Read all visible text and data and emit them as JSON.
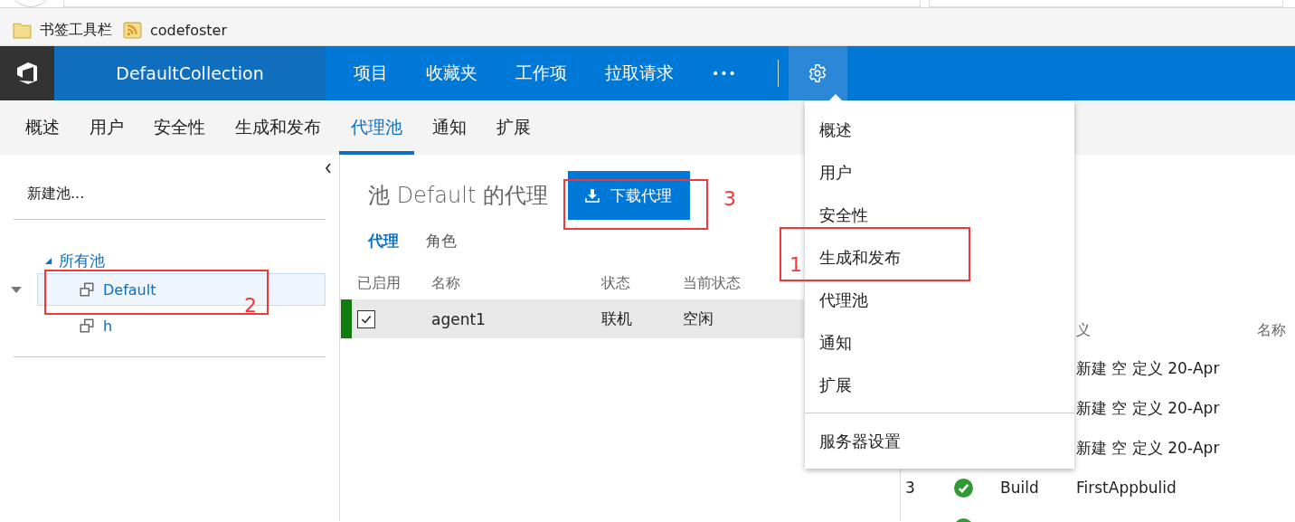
{
  "browser": {
    "bookmarks": [
      {
        "kind": "folder",
        "label": "书签工具栏"
      },
      {
        "kind": "feed",
        "label": "codefoster"
      }
    ]
  },
  "header": {
    "collection": "DefaultCollection",
    "nav": [
      {
        "label": "项目"
      },
      {
        "label": "收藏夹"
      },
      {
        "label": "工作项"
      },
      {
        "label": "拉取请求"
      }
    ],
    "more": "•••",
    "settings_open": true
  },
  "subnav": [
    {
      "label": "概述",
      "selected": false
    },
    {
      "label": "用户",
      "selected": false
    },
    {
      "label": "安全性",
      "selected": false
    },
    {
      "label": "生成和发布",
      "selected": false
    },
    {
      "label": "代理池",
      "selected": true
    },
    {
      "label": "通知",
      "selected": false
    },
    {
      "label": "扩展",
      "selected": false
    }
  ],
  "sidebar": {
    "new_pool": "新建池...",
    "tree": {
      "label": "所有池",
      "expanded": true,
      "children": [
        {
          "label": "Default",
          "selected": true,
          "expanded": true
        },
        {
          "label": "h",
          "selected": false,
          "expanded": false
        }
      ]
    }
  },
  "main": {
    "title": "池 Default 的代理",
    "download_button": "下载代理",
    "tabs": [
      {
        "label": "代理",
        "selected": true
      },
      {
        "label": "角色",
        "selected": false
      }
    ],
    "table": {
      "columns": [
        "已启用",
        "名称",
        "状态",
        "当前状态"
      ],
      "rows": [
        {
          "enabled": true,
          "online": true,
          "selected": true,
          "name": "agent1",
          "status": "联机",
          "current_status": "空闲"
        }
      ]
    }
  },
  "builds_table": {
    "columns": [
      {
        "label": "义"
      },
      {
        "label": "名称"
      }
    ],
    "rows": [
      {
        "definition": "新建 空 定义 20-Apr"
      },
      {
        "definition": "新建 空 定义 20-Apr"
      },
      {
        "definition": "新建 空 定义 20-Apr"
      },
      {
        "number": "3",
        "succeeded": true,
        "type": "Build",
        "definition": "FirstAppbulid"
      },
      {
        "succeeded": true
      }
    ]
  },
  "settings_menu": {
    "items": [
      {
        "label": "概述"
      },
      {
        "label": "用户"
      },
      {
        "label": "安全性"
      },
      {
        "label": "生成和发布"
      },
      {
        "label": "代理池"
      },
      {
        "label": "通知"
      },
      {
        "label": "扩展"
      }
    ],
    "footer_items": [
      {
        "label": "服务器设置"
      }
    ]
  },
  "annotations": [
    {
      "label": "3"
    },
    {
      "label": "2"
    },
    {
      "label": "1"
    }
  ]
}
